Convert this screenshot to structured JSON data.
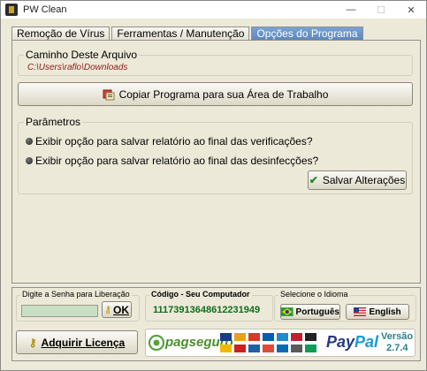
{
  "window": {
    "title": "PW Clean",
    "minimize": "—",
    "maximize": "☐",
    "close": "✕"
  },
  "tabs": [
    {
      "label": "Remoção de Vírus"
    },
    {
      "label": "Ferramentas / Manutenção"
    },
    {
      "label": "Opções do Programa",
      "active": true
    }
  ],
  "path_section": {
    "title": "Caminho Deste Arquivo",
    "path": "C:\\Users\\raflo\\Downloads"
  },
  "copy_button": {
    "label": "Copiar Programa para sua Área de Trabalho"
  },
  "params": {
    "title": "Parâmetros",
    "options": [
      "Exibir opção para salvar relatório ao final das verificações?",
      "Exibir opção para salvar relatório ao final das desinfecções?"
    ],
    "save_label": "Salvar Alterações"
  },
  "password": {
    "title": "Digite a Senha para Liberação",
    "value": "",
    "ok_label": "OK"
  },
  "computer_code": {
    "title": "Código - Seu Computador",
    "code": "11173913648612231949"
  },
  "language": {
    "title": "Selecione o Idioma",
    "portuguese": "Português",
    "english": "English"
  },
  "buy_button": {
    "label": "Adquirir Licença"
  },
  "payment": {
    "pagseguro": "pagseguro",
    "paypal_pay": "Pay",
    "paypal_pal": "Pal"
  },
  "version": {
    "label": "Versão",
    "number": "2.7.4"
  },
  "colors": {
    "accent_blue": "#5a85bd",
    "path_red": "#8b1a1a",
    "code_green": "#0b6e1c",
    "version_teal": "#2a7f8a"
  }
}
